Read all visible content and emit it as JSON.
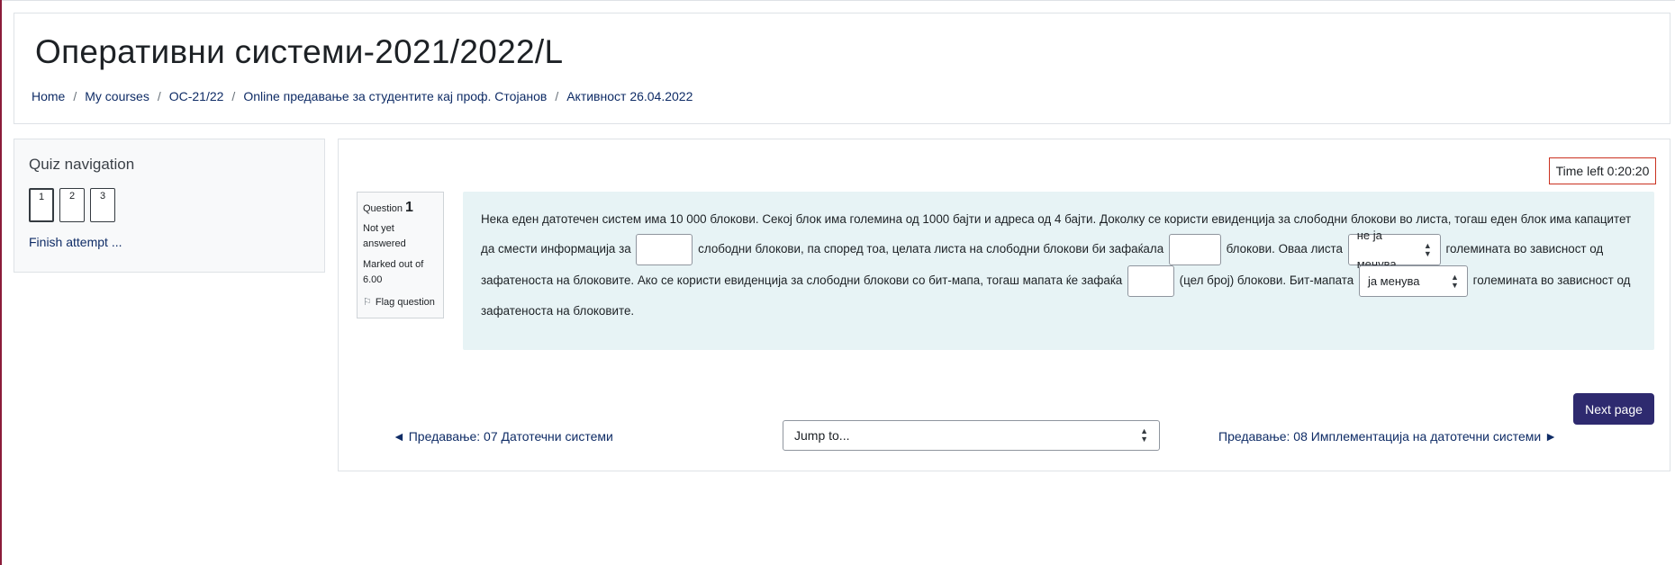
{
  "header": {
    "title": "Оперативни системи-2021/2022/L",
    "breadcrumbs": [
      "Home",
      "My courses",
      "ОС-21/22",
      "Online предавање за студентите кај проф. Стојанов",
      "Активност 26.04.2022"
    ]
  },
  "quiz_nav": {
    "title": "Quiz navigation",
    "buttons": [
      "1",
      "2",
      "3"
    ],
    "current": "1",
    "finish_label": "Finish attempt ..."
  },
  "timer": {
    "text": "Time left 0:20:20"
  },
  "question": {
    "label": "Question",
    "number": "1",
    "state": "Not yet answered",
    "grade": "Marked out of 6.00",
    "flag_label": "Flag question",
    "text": {
      "p1": "Нека еден датотечен систем има 10 000 блокови. Секој блок има големина од 1000 бајти и адреса од 4 бајти. Доколку се користи евиденција за слободни блокови во листа, тогаш еден блок има капацитет да смести информација за",
      "p2": "слободни блокови, па според тоа, целата листа на слободни блокови би зафаќала",
      "p3": "блокови. Оваа листа",
      "p4": "големината во зависност од зафатеноста на блоковите. Ако се користи евиденција за слободни блокови со бит-мапа, тогаш мапата ќе зафаќа",
      "p5": "(цел број) блокови.  Бит-мапата",
      "p6": "големината во зависност од зафатеноста на блоковите."
    },
    "inputs": [
      "",
      "",
      ""
    ],
    "select1_value": "не ја менува",
    "select2_value": "ја менува"
  },
  "navigation": {
    "next_page": "Next page",
    "prev_activity": "◄ Предавање: 07 Датотечни системи",
    "jump_placeholder": "Jump to...",
    "next_activity": "Предавање: 08 Имплементација на датотечни системи ►"
  },
  "colors": {
    "primary": "#2e2a6f",
    "link": "#0f2c66",
    "timer_border": "#ca3120",
    "question_bg": "#e7f3f5"
  }
}
